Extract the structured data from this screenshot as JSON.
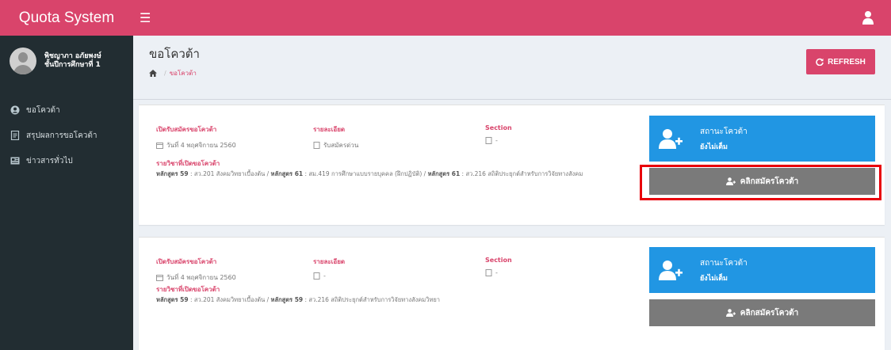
{
  "header": {
    "brand": "Quota System"
  },
  "sidebar": {
    "user_name_line1": "พิชญาภา อภัยพงษ์",
    "user_name_line2": "ชั้นปีการศึกษาที่ 1",
    "items": [
      {
        "label": "ขอโควต้า",
        "icon": "user-circle-icon"
      },
      {
        "label": "สรุปผลการขอโควต้า",
        "icon": "document-icon"
      },
      {
        "label": "ข่าวสารทั่วไป",
        "icon": "newspaper-icon"
      }
    ]
  },
  "page": {
    "title": "ขอโควต้า",
    "breadcrumb": "ขอโควต้า",
    "refresh_label": "REFRESH"
  },
  "labels": {
    "open_date": "เปิดรับสมัครขอโควต้า",
    "details": "รายละเอียด",
    "section": "Section",
    "courses": "รายวิชาที่เปิดขอโควต้า",
    "status_title": "สถานะโควต้า",
    "apply": "คลิกสมัครโควต้า"
  },
  "cards": [
    {
      "date": "วันที่ 4 พฤศจิกายน 2560",
      "detail": "รับสมัครด่วน",
      "section": "-",
      "course_parts": [
        {
          "prefix": "หลักสูตร 59",
          "text": " : สว.201 สังคมวิทยาเบื้องต้น / "
        },
        {
          "prefix": "หลักสูตร 61",
          "text": " : สม.419 การศึกษาแบบรายบุคคล (ฝึกปฏิบัติ) / "
        },
        {
          "prefix": "หลักสูตร 61",
          "text": " : สว.216 สถิติประยุกต์สำหรับการวิจัยทางสังคม"
        }
      ],
      "status": "ยังไม่เต็ม"
    },
    {
      "date": "วันที่ 4 พฤศจิกายน 2560",
      "detail": "-",
      "section": "-",
      "course_parts": [
        {
          "prefix": "หลักสูตร 59",
          "text": " : สว.201 สังคมวิทยาเบื้องต้น / "
        },
        {
          "prefix": "หลักสูตร 59",
          "text": " : สว.216 สถิติประยุกต์สำหรับการวิจัยทางสังคมวิทยา"
        }
      ],
      "status": "ยังไม่เต็ม"
    }
  ],
  "colors": {
    "accent": "#d9446b",
    "sidebar": "#222d32",
    "status": "#2196e3",
    "button": "#7a7a7a",
    "highlight": "#e8000a"
  }
}
